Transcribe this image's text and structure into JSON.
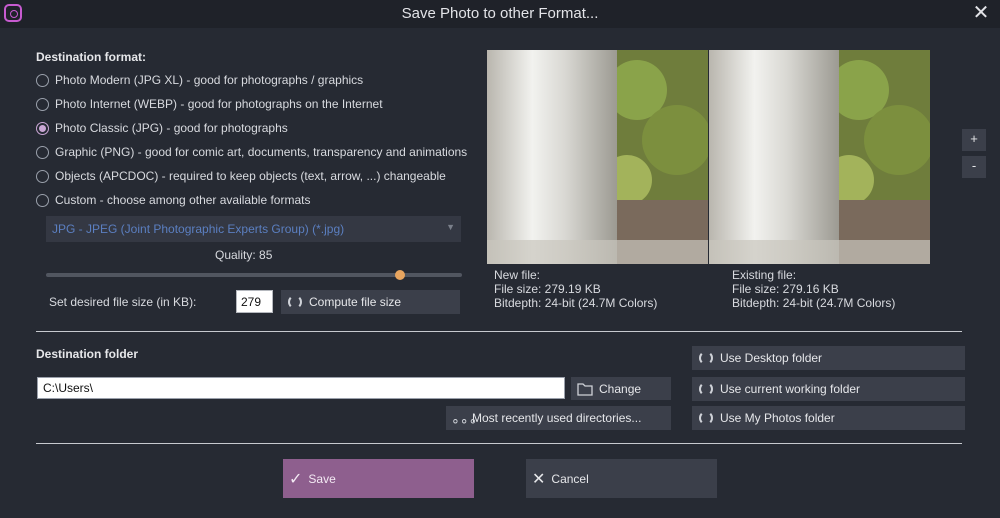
{
  "window": {
    "title": "Save Photo to other Format...",
    "close": "✕"
  },
  "format": {
    "heading": "Destination format:",
    "options": [
      {
        "label": "Photo Modern (JPG XL) - good for photographs / graphics",
        "checked": false
      },
      {
        "label": "Photo Internet (WEBP) - good for photographs on the Internet",
        "checked": false
      },
      {
        "label": "Photo Classic (JPG) - good for photographs",
        "checked": true
      },
      {
        "label": "Graphic (PNG) - good for comic art, documents, transparency and animations",
        "checked": false
      },
      {
        "label": "Objects (APCDOC) - required to keep objects (text, arrow, ...) changeable",
        "checked": false
      },
      {
        "label": "Custom - choose among other available formats",
        "checked": false
      }
    ],
    "custom_select": "JPG - JPEG (Joint Photographic Experts Group) (*.jpg)",
    "quality_label": "Quality:",
    "quality_value": "85",
    "quality_fraction": 0.85,
    "size_label": "Set desired file size (in KB):",
    "size_value": "279",
    "compute_button": "Compute file size"
  },
  "preview": {
    "zoom_in": "+",
    "zoom_out": "-",
    "new_file": {
      "title": "New file:",
      "size": "File size: 279.19 KB",
      "depth": "Bitdepth: 24-bit (24.7M Colors)"
    },
    "existing_file": {
      "title": "Existing file:",
      "size": "File size: 279.16 KB",
      "depth": "Bitdepth: 24-bit (24.7M Colors)"
    }
  },
  "folder": {
    "heading": "Destination folder",
    "path": "C:\\Users\\",
    "change_button": "Change",
    "recent_button": "Most recently used directories...",
    "desktop_button": "Use Desktop folder",
    "working_button": "Use current working folder",
    "photos_button": "Use My Photos folder"
  },
  "actions": {
    "save": "Save",
    "cancel": "Cancel"
  },
  "colors": {
    "accent": "#8e5f8e",
    "background": "#262a33",
    "slider_thumb": "#e8a55f"
  }
}
